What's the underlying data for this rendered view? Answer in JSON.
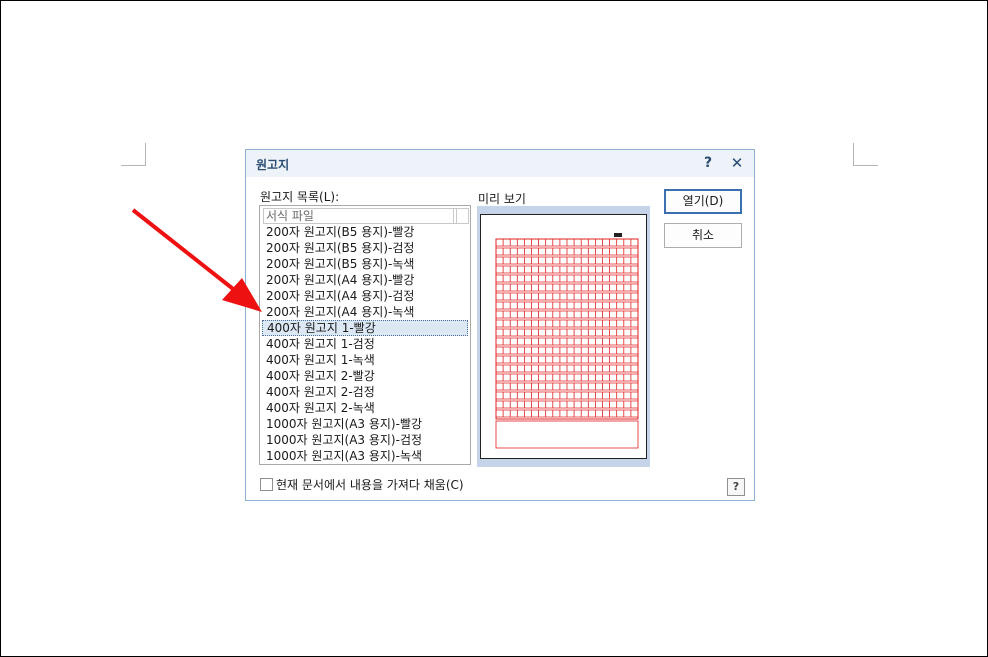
{
  "dialog": {
    "title": "원고지",
    "help_label": "?",
    "close_label": "✕",
    "list_label": "원고지 목록(L):",
    "list_header": "서식 파일",
    "preview_label": "미리 보기",
    "items": [
      "200자 원고지(B5 용지)-빨강",
      "200자 원고지(B5 용지)-검정",
      "200자 원고지(B5 용지)-녹색",
      "200자 원고지(A4 용지)-빨강",
      "200자 원고지(A4 용지)-검정",
      "200자 원고지(A4 용지)-녹색",
      "400자 원고지 1-빨강",
      "400자 원고지 1-검정",
      "400자 원고지 1-녹색",
      "400자 원고지 2-빨강",
      "400자 원고지 2-검정",
      "400자 원고지 2-녹색",
      "1000자 원고지(A3 용지)-빨강",
      "1000자 원고지(A3 용지)-검정",
      "1000자 원고지(A3 용지)-녹색"
    ],
    "selected_index": 6,
    "open_button": "열기(D)",
    "cancel_button": "취소",
    "checkbox_label": "현재 문서에서 내용을 가져다 채움(C)",
    "checkbox_checked": false,
    "help_button": "?",
    "preview_grid_color": "#e02020",
    "arrow_color": "#ee1111"
  }
}
